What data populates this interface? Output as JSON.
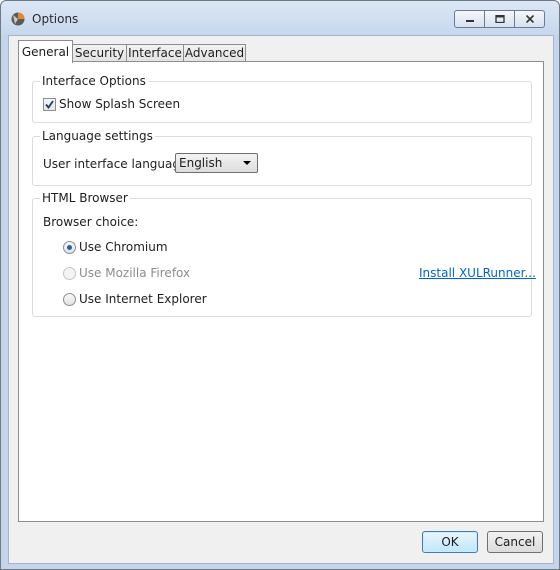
{
  "window": {
    "title": "Options"
  },
  "tabs": [
    {
      "label": "General",
      "active": true
    },
    {
      "label": "Security",
      "active": false
    },
    {
      "label": "Interface",
      "active": false
    },
    {
      "label": "Advanced",
      "active": false
    }
  ],
  "interface_options": {
    "group_label": "Interface Options",
    "splash_label": "Show Splash Screen",
    "splash_checked": true
  },
  "language_settings": {
    "group_label": "Language settings",
    "language_label": "User interface language:",
    "language_value": "English"
  },
  "html_browser": {
    "group_label": "HTML Browser",
    "choice_label": "Browser choice:",
    "options": [
      {
        "label": "Use Chromium",
        "selected": true,
        "enabled": true
      },
      {
        "label": "Use Mozilla Firefox",
        "selected": false,
        "enabled": false
      },
      {
        "label": "Use Internet Explorer",
        "selected": false,
        "enabled": true
      }
    ],
    "install_link": "Install XULRunner..."
  },
  "buttons": {
    "ok": "OK",
    "cancel": "Cancel"
  },
  "colors": {
    "link": "#0066cc",
    "radio_selected": "#2a5fad",
    "default_button_border": "#3c7fb1"
  }
}
